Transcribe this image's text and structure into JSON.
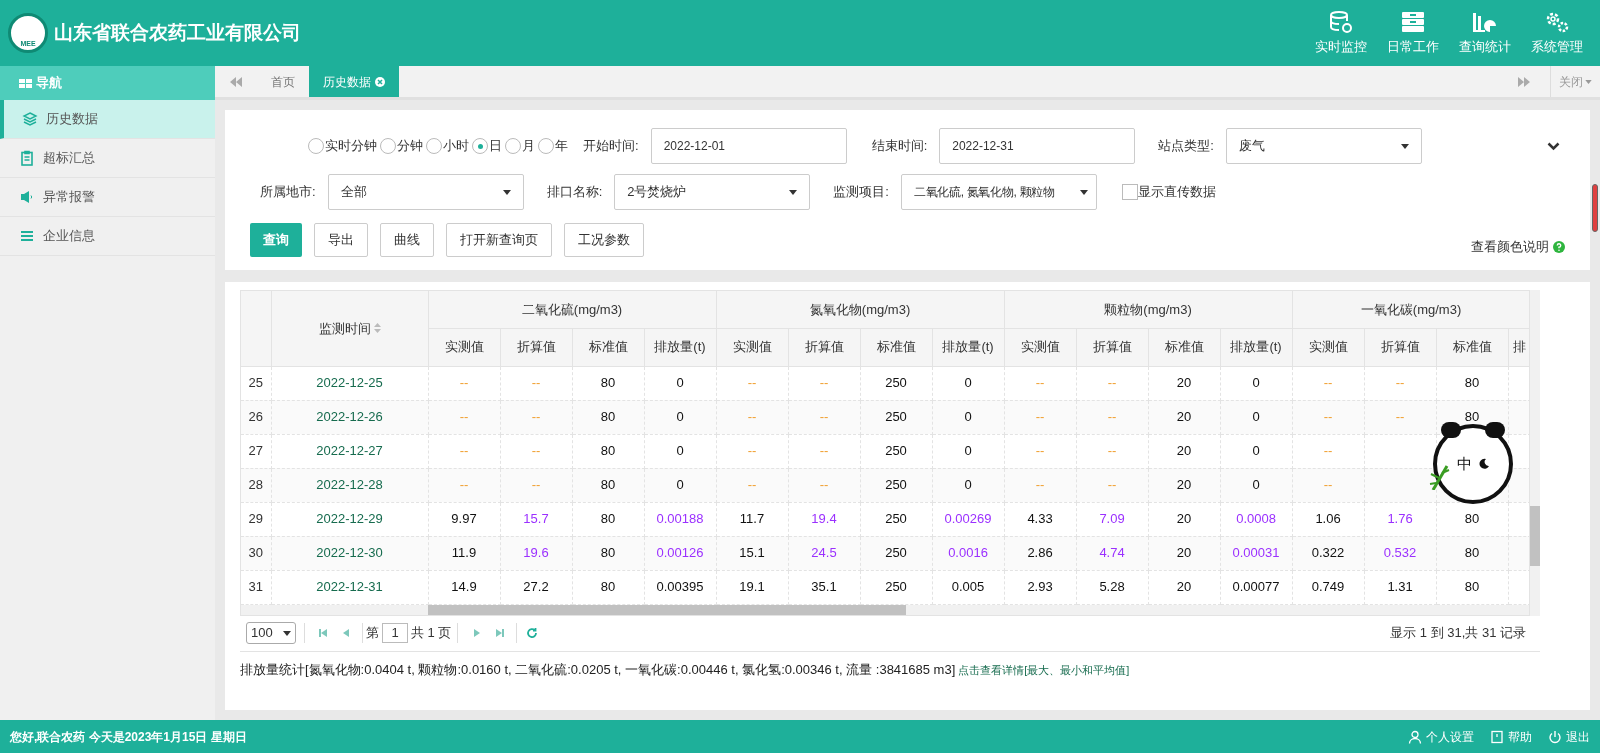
{
  "header": {
    "company": "山东省联合农药工业有限公司",
    "logo_text": "MEE",
    "nav": [
      {
        "label": "实时监控",
        "kind": "database"
      },
      {
        "label": "日常工作",
        "kind": "drawer"
      },
      {
        "label": "查询统计",
        "kind": "chart"
      },
      {
        "label": "系统管理",
        "kind": "gears"
      }
    ]
  },
  "sidebar": {
    "title": "导航",
    "items": [
      {
        "label": "历史数据",
        "kind": "layers",
        "selected": true
      },
      {
        "label": "超标汇总",
        "kind": "clipboard",
        "selected": false
      },
      {
        "label": "异常报警",
        "kind": "speaker",
        "selected": false
      },
      {
        "label": "企业信息",
        "kind": "list",
        "selected": false
      }
    ]
  },
  "tabs": [
    {
      "label": "首页",
      "selected": false,
      "closable": false
    },
    {
      "label": "历史数据",
      "selected": true,
      "closable": true
    }
  ],
  "tab_close_all": "关闭",
  "filters": {
    "periods": [
      {
        "label": "实时分钟",
        "selected": false
      },
      {
        "label": "分钟",
        "selected": false
      },
      {
        "label": "小时",
        "selected": false
      },
      {
        "label": "日",
        "selected": true
      },
      {
        "label": "月",
        "selected": false
      },
      {
        "label": "年",
        "selected": false
      }
    ],
    "start": {
      "label": "开始时间:",
      "value": "2022-12-01"
    },
    "end": {
      "label": "结束时间:",
      "value": "2022-12-31"
    },
    "site_type": {
      "label": "站点类型:",
      "value": "废气"
    },
    "city": {
      "label": "所属地市:",
      "value": "全部"
    },
    "outlet": {
      "label": "排口名称:",
      "value": "2号焚烧炉"
    },
    "items": {
      "label": "监测项目:",
      "value": "二氧化硫, 氮氧化物, 颗粒物"
    },
    "direct": {
      "label": "显示直传数据",
      "checked": false
    },
    "buttons": [
      {
        "label": "查询",
        "primary": true
      },
      {
        "label": "导出",
        "primary": false
      },
      {
        "label": "曲线",
        "primary": false
      },
      {
        "label": "打开新查询页",
        "primary": false
      },
      {
        "label": "工况参数",
        "primary": false
      }
    ],
    "color_help": "查看颜色说明"
  },
  "table": {
    "time_header": "监测时间",
    "groups": [
      "二氧化硫(mg/m3)",
      "氮氧化物(mg/m3)",
      "颗粒物(mg/m3)",
      "一氧化碳(mg/m3)"
    ],
    "subcolumns": [
      "实测值",
      "折算值",
      "标准值",
      "排放量(t)",
      "实测值",
      "折算值",
      "标准值",
      "排放量(t)",
      "实测值",
      "折算值",
      "标准值",
      "排放量(t)",
      "实测值",
      "折算值",
      "标准值",
      "排"
    ],
    "rows": [
      {
        "index": "25",
        "time": "2022-12-25",
        "cells": [
          {
            "text": "--",
            "color": "#f0a030"
          },
          {
            "text": "--",
            "color": "#f0a030"
          },
          {
            "text": "80",
            "color": "#111111"
          },
          {
            "text": "0",
            "color": "#111111"
          },
          {
            "text": "--",
            "color": "#f0a030"
          },
          {
            "text": "--",
            "color": "#f0a030"
          },
          {
            "text": "250",
            "color": "#111111"
          },
          {
            "text": "0",
            "color": "#111111"
          },
          {
            "text": "--",
            "color": "#f0a030"
          },
          {
            "text": "--",
            "color": "#f0a030"
          },
          {
            "text": "20",
            "color": "#111111"
          },
          {
            "text": "0",
            "color": "#111111"
          },
          {
            "text": "--",
            "color": "#f0a030"
          },
          {
            "text": "--",
            "color": "#f0a030"
          },
          {
            "text": "80",
            "color": "#111111"
          }
        ]
      },
      {
        "index": "26",
        "time": "2022-12-26",
        "cells": [
          {
            "text": "--",
            "color": "#f0a030"
          },
          {
            "text": "--",
            "color": "#f0a030"
          },
          {
            "text": "80",
            "color": "#111111"
          },
          {
            "text": "0",
            "color": "#111111"
          },
          {
            "text": "--",
            "color": "#f0a030"
          },
          {
            "text": "--",
            "color": "#f0a030"
          },
          {
            "text": "250",
            "color": "#111111"
          },
          {
            "text": "0",
            "color": "#111111"
          },
          {
            "text": "--",
            "color": "#f0a030"
          },
          {
            "text": "--",
            "color": "#f0a030"
          },
          {
            "text": "20",
            "color": "#111111"
          },
          {
            "text": "0",
            "color": "#111111"
          },
          {
            "text": "--",
            "color": "#f0a030"
          },
          {
            "text": "--",
            "color": "#f0a030"
          },
          {
            "text": "80",
            "color": "#111111"
          }
        ]
      },
      {
        "index": "27",
        "time": "2022-12-27",
        "cells": [
          {
            "text": "--",
            "color": "#f0a030"
          },
          {
            "text": "--",
            "color": "#f0a030"
          },
          {
            "text": "80",
            "color": "#111111"
          },
          {
            "text": "0",
            "color": "#111111"
          },
          {
            "text": "--",
            "color": "#f0a030"
          },
          {
            "text": "--",
            "color": "#f0a030"
          },
          {
            "text": "250",
            "color": "#111111"
          },
          {
            "text": "0",
            "color": "#111111"
          },
          {
            "text": "--",
            "color": "#f0a030"
          },
          {
            "text": "--",
            "color": "#f0a030"
          },
          {
            "text": "20",
            "color": "#111111"
          },
          {
            "text": "0",
            "color": "#111111"
          },
          {
            "text": "--",
            "color": "#f0a030"
          }
        ]
      },
      {
        "index": "28",
        "time": "2022-12-28",
        "cells": [
          {
            "text": "--",
            "color": "#f0a030"
          },
          {
            "text": "--",
            "color": "#f0a030"
          },
          {
            "text": "80",
            "color": "#111111"
          },
          {
            "text": "0",
            "color": "#111111"
          },
          {
            "text": "--",
            "color": "#f0a030"
          },
          {
            "text": "--",
            "color": "#f0a030"
          },
          {
            "text": "250",
            "color": "#111111"
          },
          {
            "text": "0",
            "color": "#111111"
          },
          {
            "text": "--",
            "color": "#f0a030"
          },
          {
            "text": "--",
            "color": "#f0a030"
          },
          {
            "text": "20",
            "color": "#111111"
          },
          {
            "text": "0",
            "color": "#111111"
          },
          {
            "text": "--",
            "color": "#f0a030"
          }
        ]
      },
      {
        "index": "29",
        "time": "2022-12-29",
        "cells": [
          {
            "text": "9.97",
            "color": "#111111"
          },
          {
            "text": "15.7",
            "color": "#9b30ff"
          },
          {
            "text": "80",
            "color": "#111111"
          },
          {
            "text": "0.00188",
            "color": "#9b30ff"
          },
          {
            "text": "11.7",
            "color": "#111111"
          },
          {
            "text": "19.4",
            "color": "#9b30ff"
          },
          {
            "text": "250",
            "color": "#111111"
          },
          {
            "text": "0.00269",
            "color": "#9b30ff"
          },
          {
            "text": "4.33",
            "color": "#111111"
          },
          {
            "text": "7.09",
            "color": "#9b30ff"
          },
          {
            "text": "20",
            "color": "#111111"
          },
          {
            "text": "0.0008",
            "color": "#9b30ff"
          },
          {
            "text": "1.06",
            "color": "#111111"
          },
          {
            "text": "1.76",
            "color": "#9b30ff"
          },
          {
            "text": "80",
            "color": "#111111"
          }
        ]
      },
      {
        "index": "30",
        "time": "2022-12-30",
        "cells": [
          {
            "text": "11.9",
            "color": "#111111"
          },
          {
            "text": "19.6",
            "color": "#9b30ff"
          },
          {
            "text": "80",
            "color": "#111111"
          },
          {
            "text": "0.00126",
            "color": "#9b30ff"
          },
          {
            "text": "15.1",
            "color": "#111111"
          },
          {
            "text": "24.5",
            "color": "#9b30ff"
          },
          {
            "text": "250",
            "color": "#111111"
          },
          {
            "text": "0.0016",
            "color": "#9b30ff"
          },
          {
            "text": "2.86",
            "color": "#111111"
          },
          {
            "text": "4.74",
            "color": "#9b30ff"
          },
          {
            "text": "20",
            "color": "#111111"
          },
          {
            "text": "0.00031",
            "color": "#9b30ff"
          },
          {
            "text": "0.322",
            "color": "#111111"
          },
          {
            "text": "0.532",
            "color": "#9b30ff"
          },
          {
            "text": "80",
            "color": "#111111"
          }
        ]
      },
      {
        "index": "31",
        "time": "2022-12-31",
        "cells": [
          {
            "text": "14.9",
            "color": "#111111"
          },
          {
            "text": "27.2",
            "color": "#111111"
          },
          {
            "text": "80",
            "color": "#111111"
          },
          {
            "text": "0.00395",
            "color": "#111111"
          },
          {
            "text": "19.1",
            "color": "#111111"
          },
          {
            "text": "35.1",
            "color": "#111111"
          },
          {
            "text": "250",
            "color": "#111111"
          },
          {
            "text": "0.005",
            "color": "#111111"
          },
          {
            "text": "2.93",
            "color": "#111111"
          },
          {
            "text": "5.28",
            "color": "#111111"
          },
          {
            "text": "20",
            "color": "#111111"
          },
          {
            "text": "0.00077",
            "color": "#111111"
          },
          {
            "text": "0.749",
            "color": "#111111"
          },
          {
            "text": "1.31",
            "color": "#111111"
          },
          {
            "text": "80",
            "color": "#111111"
          }
        ]
      }
    ]
  },
  "pager": {
    "page_size": "100",
    "page_prefix": "第",
    "page": "1",
    "page_suffix": "共 1 页",
    "summary": "显示 1 到 31,共 31 记录"
  },
  "stats": {
    "text": "排放量统计[氮氧化物:0.0404 t, 颗粒物:0.0160 t, 二氧化硫:0.0205 t, 一氧化碳:0.00446 t, 氯化氢:0.00346 t, 流量 :3841685 m3]",
    "link": "点击查看详情[最大、最小和平均值]"
  },
  "ime_widget": {
    "label": "中"
  },
  "footer": {
    "greeting": "您好,联合农药 今天是2023年1月15日 星期日",
    "links": [
      {
        "label": "个人设置",
        "kind": "user"
      },
      {
        "label": "帮助",
        "kind": "book"
      },
      {
        "label": "退出",
        "kind": "power"
      }
    ]
  }
}
